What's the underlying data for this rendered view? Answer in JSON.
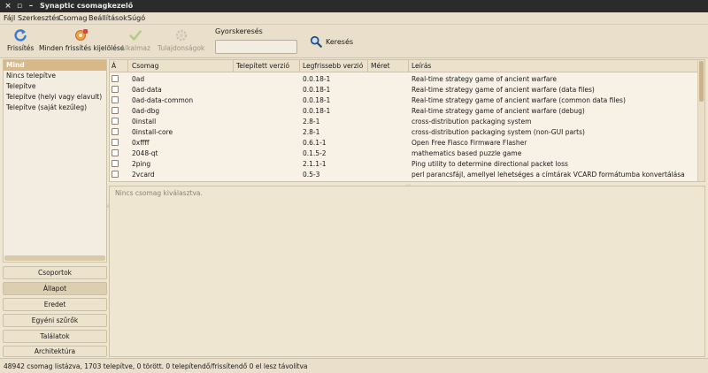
{
  "window": {
    "title": "Synaptic csomagkezelő"
  },
  "menu": [
    "Fájl",
    "Szerkesztés",
    "Csomag",
    "Beállítások",
    "Súgó"
  ],
  "toolbar": {
    "reload_label": "Frissítés",
    "mark_all_label": "Minden frissítés kijelölése",
    "apply_label": "Alkalmaz",
    "properties_label": "Tulajdonságok",
    "quick_search_label": "Gyorskeresés",
    "quick_search_value": "",
    "search_label": "Keresés"
  },
  "sidebar": {
    "items": [
      "Mind",
      "Nincs telepítve",
      "Telepítve",
      "Telepítve (helyi vagy elavult)",
      "Telepítve (saját kezűleg)"
    ],
    "selected_index": 0
  },
  "filter_buttons": [
    "Csoportok",
    "Állapot",
    "Eredet",
    "Egyéni szűrők",
    "Találatok",
    "Architektúra"
  ],
  "filter_active_index": 1,
  "table": {
    "headers": [
      "Á",
      "Csomag",
      "Telepített verzió",
      "Legfrissebb verzió",
      "Méret",
      "Leírás"
    ],
    "rows": [
      {
        "name": "0ad",
        "installed": "",
        "latest": "0.0.18-1",
        "size": "",
        "desc": "Real-time strategy game of ancient warfare"
      },
      {
        "name": "0ad-data",
        "installed": "",
        "latest": "0.0.18-1",
        "size": "",
        "desc": "Real-time strategy game of ancient warfare (data files)"
      },
      {
        "name": "0ad-data-common",
        "installed": "",
        "latest": "0.0.18-1",
        "size": "",
        "desc": "Real-time strategy game of ancient warfare (common data files)"
      },
      {
        "name": "0ad-dbg",
        "installed": "",
        "latest": "0.0.18-1",
        "size": "",
        "desc": "Real-time strategy game of ancient warfare (debug)"
      },
      {
        "name": "0install",
        "installed": "",
        "latest": "2.8-1",
        "size": "",
        "desc": "cross-distribution packaging system"
      },
      {
        "name": "0install-core",
        "installed": "",
        "latest": "2.8-1",
        "size": "",
        "desc": "cross-distribution packaging system (non-GUI parts)"
      },
      {
        "name": "0xffff",
        "installed": "",
        "latest": "0.6.1-1",
        "size": "",
        "desc": "Open Free Fiasco Firmware Flasher"
      },
      {
        "name": "2048-qt",
        "installed": "",
        "latest": "0.1.5-2",
        "size": "",
        "desc": "mathematics based puzzle game"
      },
      {
        "name": "2ping",
        "installed": "",
        "latest": "2.1.1-1",
        "size": "",
        "desc": "Ping utility to determine directional packet loss"
      },
      {
        "name": "2vcard",
        "installed": "",
        "latest": "0.5-3",
        "size": "",
        "desc": "perl parancsfájl, amellyel lehetséges a címtárak VCARD formátumba konvertálása"
      }
    ]
  },
  "details": {
    "message": "Nincs csomag kiválasztva."
  },
  "status": {
    "text": "48942 csomag listázva, 1703 telepítve, 0 törött. 0 telepítendő/frissítendő 0 el lesz távolítva"
  },
  "colors": {
    "selection": "#d9b888",
    "background": "#efe6d2",
    "titlebar": "#2b2b2b"
  }
}
